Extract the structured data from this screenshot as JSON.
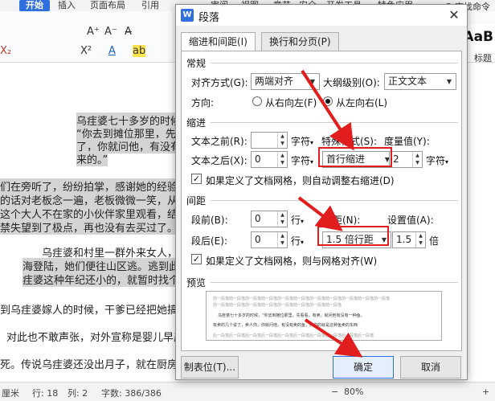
{
  "ribbon": {
    "tabs": [
      "开始",
      "插入",
      "页面布局",
      "引用",
      "审阅",
      "视图",
      "章节",
      "安全",
      "开发工具",
      "特色应用"
    ],
    "search": "Q 查找命令",
    "style_preview": "AaB",
    "style_name": "标题"
  },
  "toolbar": {
    "font_size_up": "A⁺",
    "font_size_down": "A⁻",
    "clear_format": "A̶",
    "superscript": "X²",
    "subscript": "X₂",
    "font_color": "A",
    "highlight": "ab"
  },
  "document": {
    "lines": [
      "乌疰婆七十多岁的时候",
      "“你去到摊位那里，先",
      "了，你就问他，有没有",
      "来的。”",
      "们在旁听了，纷纷拍掌，感谢她的经验之",
      "的话对老板念一遍，老板微微一笑，从后",
      "这个大人不在家的小伙伴家里观看，结局",
      "禁失望到了极点，再也没有去买过了。",
      "乌疰婆和村里一群外来女人，",
      "海登陆，她们便往山区逃。逃到此",
      "疰婆这种年纪还小的，就暂时找个",
      "到乌疰婆嫁人的时候，干爹已经把她搞怕",
      "对此也不敢声张，对外宣称是婴儿早产",
      "死。传说乌疰婆还没出月子，就在厨房"
    ]
  },
  "statusbar": {
    "unit": "厘米",
    "row": "行: 18",
    "col": "列: 2",
    "wordcount": "字数: 386/386",
    "zoom": "80%",
    "zoom_minus": "−",
    "zoom_plus": "+"
  },
  "dialog": {
    "title": "段落",
    "close": "✕",
    "tabs": [
      "缩进和间距(I)",
      "换行和分页(P)"
    ],
    "general": {
      "label": "常规",
      "alignment_label": "对齐方式(G):",
      "alignment_value": "两端对齐",
      "outline_label": "大纲级别(O):",
      "outline_value": "正文文本",
      "direction_label": "方向:",
      "rtl_label": "从右向左(F)",
      "ltr_label": "从左向右(L)"
    },
    "indent": {
      "label": "缩进",
      "before_label": "文本之前(R):",
      "before_value": "",
      "before_unit": "字符",
      "after_label": "文本之后(X):",
      "after_value": "0",
      "after_unit": "字符",
      "special_label": "特殊格式(S):",
      "special_value": "首行缩进",
      "measure_label": "度量值(Y):",
      "measure_value": "2",
      "measure_unit": "字符",
      "grid_checkbox": "如果定义了文档网格，则自动调整右缩进(D)"
    },
    "spacing": {
      "label": "间距",
      "before_label": "段前(B):",
      "before_value": "0",
      "before_unit": "行",
      "after_label": "段后(E):",
      "after_value": "0",
      "after_unit": "行",
      "line_label": "行距(N):",
      "line_value": "1.5 倍行距",
      "set_label": "设置值(A):",
      "set_value": "1.5",
      "set_unit": "倍",
      "grid_checkbox": "如果定义了文档网格，则与网格对齐(W)"
    },
    "preview": {
      "label": "预览",
      "lines": [
        "前一段落前一段落前一段落前一段落前一段落前一段落前一段落前一段落前一段落前一段落前一段落",
        "前一段落前一段落前一段落前一段落前一段落前一段落前一段落前一段落",
        "乌疰婆七十多岁的时候，“你去到摊位那里，先看看，有卖，就问他有没有一种鱼。",
        "有卖的几个说了，卖人你，你就问他，有没有卖的鱼，卖你的就是这种鱼卖的东西",
        "后一段落后一段落后一段落后一段落后一段落后一段落后一段落后一段落后一段落后一段落"
      ]
    },
    "buttons": {
      "tabs": "制表位(T)...",
      "ok": "确定",
      "cancel": "取消"
    }
  },
  "colors": {
    "accent": "#2f6fe0",
    "annotation_red": "#e21d1d",
    "highlight_gray": "#d4d4d4"
  }
}
